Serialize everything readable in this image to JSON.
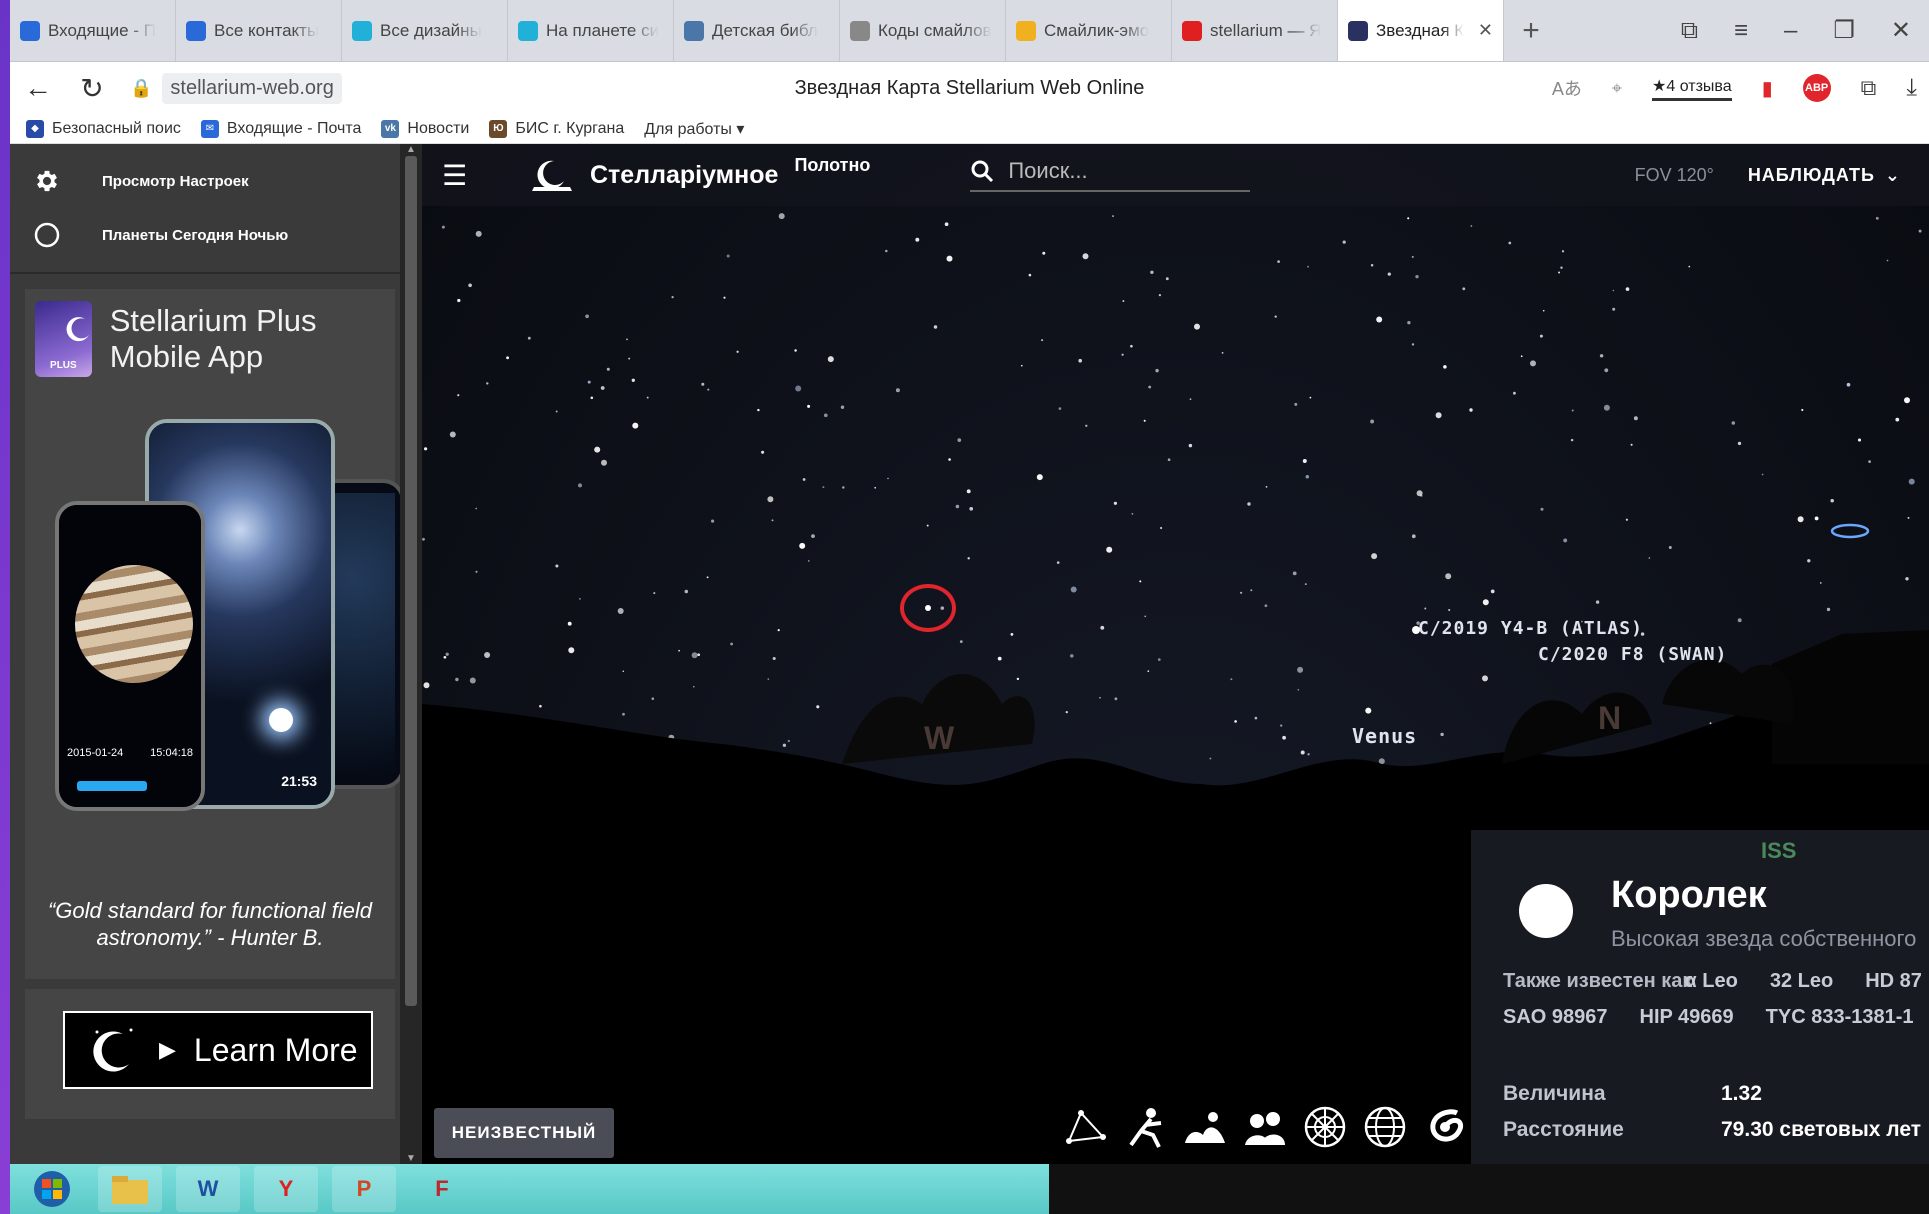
{
  "browser": {
    "tabs": [
      {
        "label": "Входящие - П",
        "icon": "mail-icon",
        "color": "#2a6ad8"
      },
      {
        "label": "Все контакты",
        "icon": "mail-icon",
        "color": "#2a6ad8"
      },
      {
        "label": "Все дизайны",
        "icon": "canva-icon",
        "color": "#20b0d8"
      },
      {
        "label": "На планете си",
        "icon": "canva-icon",
        "color": "#20b0d8"
      },
      {
        "label": "Детская библ",
        "icon": "vk-icon",
        "color": "#4a76a8"
      },
      {
        "label": "Коды смайлов",
        "icon": "page-icon",
        "color": "#888888"
      },
      {
        "label": "Смайлик-эмо",
        "icon": "smiley-icon",
        "color": "#f0b020"
      },
      {
        "label": "stellarium — Я",
        "icon": "yandex-icon",
        "color": "#e02020"
      },
      {
        "label": "Звездная К",
        "icon": "stellarium-icon",
        "color": "#2a3060"
      }
    ],
    "new_tab": "+",
    "url": "stellarium-web.org",
    "page_title": "Звездная Карта Stellarium Web Online",
    "reviews": "★4 отзыва",
    "abp": "ABP",
    "bookmarks": [
      {
        "label": "Безопасный поис",
        "icon": "shield-icon"
      },
      {
        "label": "Входящие - Почта",
        "icon": "mail-icon"
      },
      {
        "label": "Новости",
        "icon": "vk-icon"
      },
      {
        "label": "БИС г. Кургана",
        "icon": "library-icon"
      },
      {
        "label": "Для работы ▾",
        "icon": ""
      }
    ]
  },
  "sidebar": {
    "menu": [
      {
        "label": "Просмотр Настроек",
        "icon": "gear-icon"
      },
      {
        "label": "Планеты Сегодня Ночью",
        "icon": "circle-icon"
      }
    ],
    "ad": {
      "title": "Stellarium Plus Mobile App",
      "icon_text": "PLUS",
      "quote": "“Gold standard for functional field astronomy.” - Hunter B.",
      "phone_date": "2015-01-24",
      "phone_time": "15:04:18",
      "phone_clock": "21:53",
      "learn_more": "Learn More"
    }
  },
  "app": {
    "brand": "Стелларiумное",
    "brand_sup": "Полотно",
    "search_placeholder": "Поиск...",
    "fov": "FOV 120°",
    "observe": "НАБЛЮДАТЬ",
    "unknown_button": "НЕИЗВЕСТНЫЙ",
    "sky_labels": {
      "comet1": "C/2019 Y4-B (ATLAS)",
      "comet2": "C/2020 F8 (SWAN)",
      "venus": "Venus",
      "west": "W",
      "north": "N",
      "iss": "ISS"
    },
    "tools": [
      "constellation-lines-icon",
      "constellation-art-icon",
      "landscape-icon",
      "atmosphere-icon",
      "azimuthal-grid-icon",
      "equatorial-grid-icon",
      "dso-icon"
    ]
  },
  "info": {
    "name": "Королек",
    "type": "Высокая звезда собственного",
    "aka_label": "Также известен как",
    "aka_row1": [
      "α Leo",
      "32 Leo",
      "HD 87"
    ],
    "aka_row2": [
      "SAO 98967",
      "HIP 49669",
      "TYC 833-1381-1"
    ],
    "magnitude_label": "Величина",
    "magnitude": "1.32",
    "distance_label": "Расстояние",
    "distance": "79.30 световых лет"
  },
  "taskbar": [
    "start-icon",
    "explorer-icon",
    "word-icon",
    "yandex-browser-icon",
    "powerpoint-icon",
    "paint-icon"
  ]
}
